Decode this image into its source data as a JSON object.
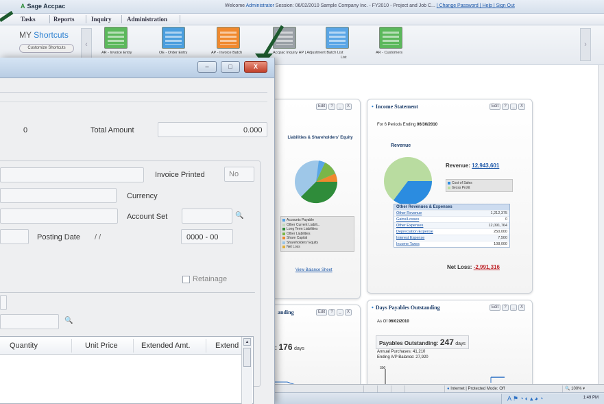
{
  "portal": {
    "brand": "Sage Accpac",
    "welcome_prefix": "Welcome",
    "welcome_user": "Administrator",
    "welcome_rest": "Session: 06/02/2010 Sample Company Inc. - FY2010 - Project and Job C...",
    "welcome_links": "| Change Password | Help | Sign Out",
    "menu": [
      "Tasks",
      "Reports",
      "Inquiry",
      "Administration"
    ],
    "shortcuts_title_prefix": "MY",
    "shortcuts_title": "Shortcuts",
    "customize_label": "Customize Shortcuts",
    "tiles": [
      {
        "label": "AR - Invoice Entry",
        "color": "#5cb85c"
      },
      {
        "label": "OE - Order Entry",
        "color": "#4a9ede"
      },
      {
        "label": "AP - Invoice Batch",
        "color": "#f0892e"
      },
      {
        "label": "AP - Vendor Inquiry",
        "color": "#9aa0a6"
      },
      {
        "label": "Accpac Inquiry HP | Adjustment Batch List",
        "color": "#5aa6e6"
      },
      {
        "label": "AR - Customers",
        "color": "#5cb85c"
      }
    ],
    "tile_label_line2": "List"
  },
  "balance_widget": {
    "chart_title": "Liabilities & Shareholders' Equity",
    "legend": [
      {
        "label": "Accounts Payable",
        "color": "#5aa6e6"
      },
      {
        "label": "Other Current Liabili...",
        "color": "#c8dcc0"
      },
      {
        "label": "Long Term Liabilities",
        "color": "#2f8c3a"
      },
      {
        "label": "Other Liabilities",
        "color": "#7ab648"
      },
      {
        "label": "Share Capital",
        "color": "#f0892e"
      },
      {
        "label": "Shareholders' Equity",
        "color": "#9ec7e8"
      },
      {
        "label": "Net Loss",
        "color": "#e2b13c"
      }
    ],
    "link": "View Balance Sheet"
  },
  "income_widget": {
    "title": "Income Statement",
    "period_prefix": "For 6 Periods Ending",
    "period_date": "06/30/2010",
    "chart_title": "Revenue",
    "revenue_label": "Revenue:",
    "revenue_value": "12,943,601",
    "legend": [
      {
        "label": "Cost of Sales",
        "color": "#2b8ce0"
      },
      {
        "label": "Gross Profit",
        "color": "#b9dca0"
      }
    ],
    "table_title": "Other Revenues & Expenses",
    "rows": [
      {
        "label": "Other Revenue",
        "value": "1,212,375"
      },
      {
        "label": "Gains/Losses",
        "value": "0"
      },
      {
        "label": "Other Expenses",
        "value": "12,091,764"
      },
      {
        "label": "Depreciation Expense",
        "value": "250,000"
      },
      {
        "label": "Interest Expense",
        "value": "7,500"
      },
      {
        "label": "Income Taxes",
        "value": "108,000"
      }
    ],
    "net_label": "Net Loss:",
    "net_value": "-2,991,316"
  },
  "dso_widget": {
    "title_tail": "anding",
    "value_prefix": ": ",
    "value": "176",
    "unit": "days"
  },
  "dpo_widget": {
    "title": "Days Payables Outstanding",
    "as_of_prefix": "As Of",
    "as_of_date": "06/02/2010",
    "stat_label": "Payables Outstanding:",
    "stat_value": "247",
    "stat_unit": "days",
    "annual_purchases": "Annual Purchases:  41,210",
    "ending_balance": "Ending A/P Balance:  27,920",
    "axis_tick": "300"
  },
  "widget_controls": [
    "Edit",
    "?",
    "_",
    "X"
  ],
  "statusbar": {
    "zone": "Internet | Protected Mode: Off",
    "zoom": "100%",
    "clock": "1:49 PM"
  },
  "dialog": {
    "title_buttons": [
      "–",
      "□",
      "X"
    ],
    "count_value": "0",
    "total_amount_label": "Total Amount",
    "total_amount_value": "0.000",
    "invoice_printed_label": "Invoice Printed",
    "invoice_printed_value": "No",
    "currency_label": "Currency",
    "account_set_label": "Account Set",
    "posting_date_label": "Posting Date",
    "posting_date_value": "/  /",
    "year_period_value": "0000 - 00",
    "retainage_label": "Retainage",
    "columns": [
      "Quantity",
      "Unit Price",
      "Extended Amt.",
      "Extend"
    ]
  }
}
